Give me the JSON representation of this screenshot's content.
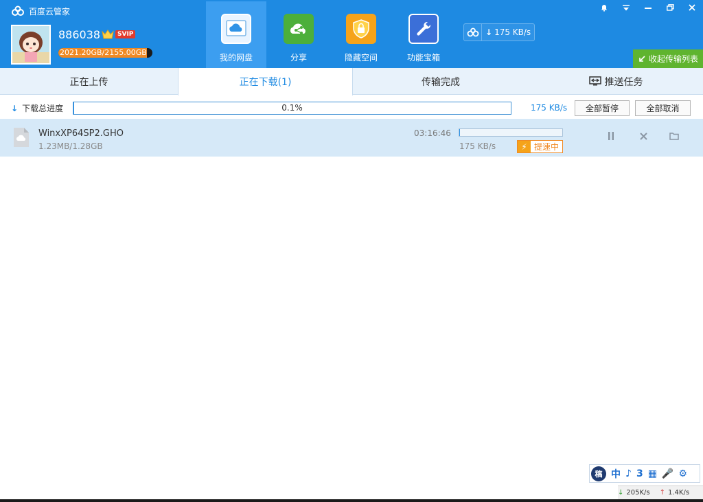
{
  "app": {
    "title": "百度云管家"
  },
  "user": {
    "name": "886038",
    "vip_badge": "SVIP",
    "quota_text": "2021.20GB/2155.00GB",
    "quota_fraction": 0.938
  },
  "nav": [
    {
      "label": "我的网盘",
      "icon": "cloud-drive-icon",
      "active": true
    },
    {
      "label": "分享",
      "icon": "share-icon",
      "active": false
    },
    {
      "label": "隐藏空间",
      "icon": "lock-icon",
      "active": false
    },
    {
      "label": "功能宝箱",
      "icon": "tools-icon",
      "active": false
    }
  ],
  "speed_widget": {
    "speed": "175 KB/s"
  },
  "collapse_label": "收起传输列表",
  "tabs": [
    {
      "label": "正在上传",
      "active": false
    },
    {
      "label": "正在下载(1)",
      "active": true
    },
    {
      "label": "传输完成",
      "active": false
    },
    {
      "label": "推送任务",
      "active": false
    }
  ],
  "total_progress": {
    "label": "下载总进度",
    "percent_text": "0.1%",
    "fraction": 0.001,
    "speed": "175 KB/s",
    "pause_all": "全部暂停",
    "cancel_all": "全部取消"
  },
  "downloads": [
    {
      "name": "WinxXP64SP2.GHO",
      "size": "1.23MB/1.28GB",
      "time_left": "03:16:46",
      "speed": "175 KB/s",
      "fraction": 0.001,
      "boost_label": "提速中"
    }
  ],
  "ime": {
    "logo": "稿",
    "mode": "中",
    "items": [
      "♪",
      "3",
      "▦",
      "🎤",
      "⚙"
    ]
  },
  "status": {
    "down": "205K/s",
    "up": "1.4K/s"
  },
  "colors": {
    "header": "#1e8ae2",
    "accent": "#1e8ae2",
    "boost": "#f08a24",
    "collapse": "#5fb42f"
  }
}
